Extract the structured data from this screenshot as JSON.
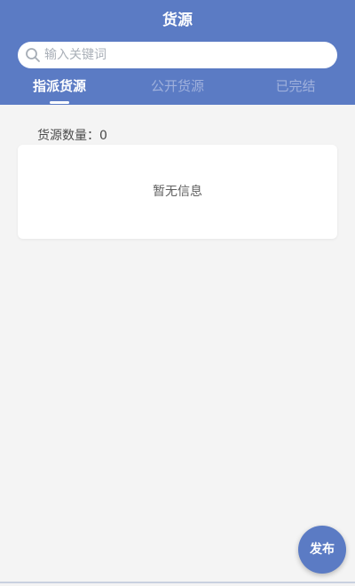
{
  "header": {
    "title": "货源"
  },
  "search": {
    "placeholder": "输入关键词",
    "value": ""
  },
  "tabs": [
    {
      "label": "指派货源",
      "active": true
    },
    {
      "label": "公开货源",
      "active": false
    },
    {
      "label": "已完结",
      "active": false
    }
  ],
  "list": {
    "count_label": "货源数量：0",
    "empty_text": "暂无信息"
  },
  "fab": {
    "label": "发布"
  },
  "colors": {
    "primary": "#5b7bc4",
    "background": "#f4f4f4",
    "card": "#ffffff"
  },
  "icons": {
    "search": "search-icon"
  }
}
